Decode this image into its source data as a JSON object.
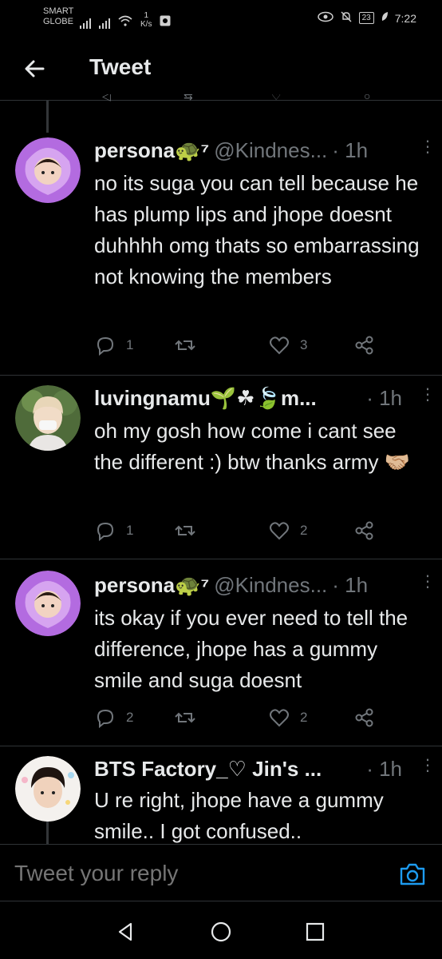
{
  "status_bar": {
    "carrier_line1": "SMART",
    "carrier_line2": "GLOBE",
    "net_speed_value": "1",
    "net_speed_unit": "K/s",
    "battery": "23",
    "time": "7:22"
  },
  "header": {
    "title": "Tweet"
  },
  "tweets": [
    {
      "display_name": "persona🐢⁷",
      "handle": "@Kindnes...",
      "time": "· 1h",
      "text": "no its suga you can tell because he has plump lips and jhope doesnt duhhhh omg thats so embarrassing not knowing the members",
      "replies": "1",
      "retweets": "",
      "likes": "3"
    },
    {
      "display_name": "luvingnamu🌱☘🍃m...",
      "handle": "",
      "time": "· 1h",
      "text": "oh my gosh how come i cant see the different :) btw thanks army 🤝🏼",
      "replies": "1",
      "retweets": "",
      "likes": "2"
    },
    {
      "display_name": "persona🐢⁷",
      "handle": "@Kindnes...",
      "time": "· 1h",
      "text": "its okay if you ever need to tell the difference, jhope has a gummy smile and suga doesnt",
      "replies": "2",
      "retweets": "",
      "likes": "2"
    },
    {
      "display_name": "BTS Factory_♡ Jin's ...",
      "handle": "",
      "time": "· 1h",
      "text": "U re right, jhope have a gummy smile.. I got confused..",
      "replies": "",
      "retweets": "",
      "likes": ""
    }
  ],
  "reply_bar": {
    "placeholder": "Tweet your reply"
  },
  "colors": {
    "background": "#000000",
    "accent": "#1d9bf0",
    "muted": "#71767b",
    "text": "#e7e9ea",
    "avatar_purple": "#b36be0"
  },
  "icons": [
    "back-arrow-icon",
    "reply-icon",
    "retweet-icon",
    "heart-icon",
    "share-icon",
    "camera-icon",
    "nav-back-icon",
    "nav-home-icon",
    "nav-recents-icon"
  ]
}
